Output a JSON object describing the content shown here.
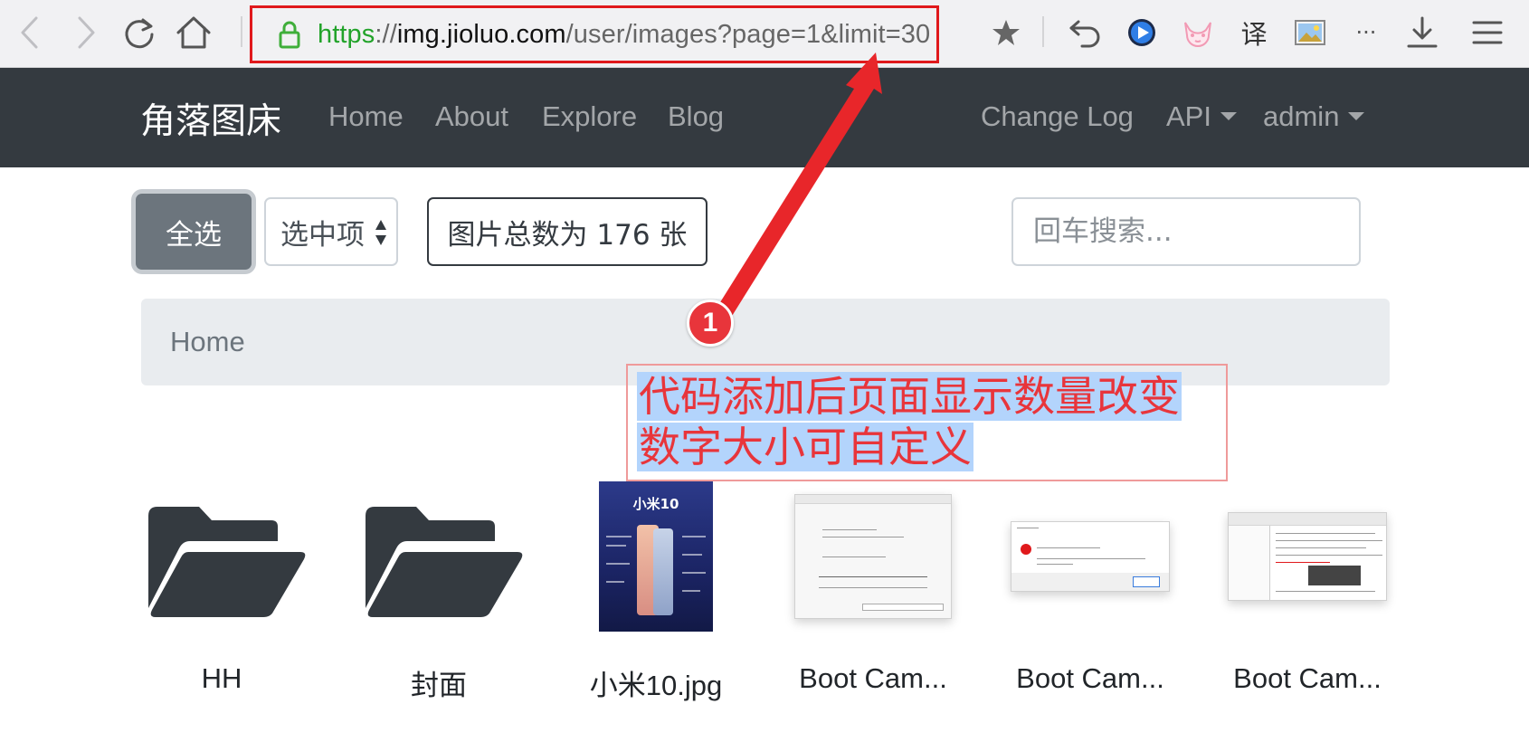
{
  "browser": {
    "url": {
      "scheme": "https",
      "separator": "://",
      "host": "img.jioluo.com",
      "path": "/user/images?page=1&limit=30"
    },
    "translate_label": "译",
    "more_label": "···",
    "icons": [
      "back-icon",
      "forward-icon",
      "reload-icon",
      "home-icon",
      "lock-icon",
      "bookmark-star-icon",
      "undo-icon",
      "player-icon",
      "cat-extension-icon",
      "translate-icon",
      "screenshot-icon",
      "more-icon",
      "download-icon",
      "menu-icon"
    ],
    "accent_url_green": "#22a32a",
    "annotation_red": "#e0191c"
  },
  "navbar": {
    "brand": "角落图床",
    "links": [
      "Home",
      "About",
      "Explore",
      "Blog"
    ],
    "right_links": [
      "Change Log",
      "API",
      "admin"
    ],
    "background": "#343a40"
  },
  "toolbar": {
    "select_all_label": "全选",
    "selected_items_label": "选中项",
    "total_label": "图片总数为 176 张",
    "search_placeholder": "回车搜索..."
  },
  "breadcrumb": {
    "items": [
      "Home"
    ]
  },
  "grid": {
    "items": [
      {
        "label": "HH",
        "kind": "folder"
      },
      {
        "label": "封面",
        "kind": "folder"
      },
      {
        "label": "小米10.jpg",
        "kind": "image",
        "poster_title": "小米10"
      },
      {
        "label": "Boot Cam...",
        "kind": "image"
      },
      {
        "label": "Boot Cam...",
        "kind": "image"
      },
      {
        "label": "Boot Cam...",
        "kind": "image"
      }
    ]
  },
  "annotation": {
    "number": "1",
    "lines": [
      "代码添加后页面显示数量改变",
      "数字大小可自定义"
    ]
  }
}
